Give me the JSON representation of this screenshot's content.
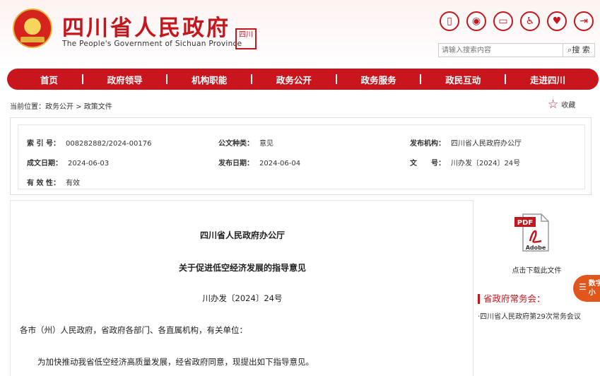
{
  "header": {
    "title": "四川省人民政府",
    "subtitle": "The People's Government of Sichuan Province",
    "seal_text": "四川"
  },
  "toolbar": {
    "icons": [
      "mobile-icon",
      "weibo-icon",
      "wechat-icon",
      "accessibility-icon",
      "elder-care-icon",
      "exit-icon"
    ]
  },
  "search": {
    "placeholder": "请输入搜索内容",
    "button_label": "搜 索"
  },
  "nav": {
    "items": [
      "首页",
      "政府领导",
      "机构职能",
      "政务公开",
      "政务服务",
      "政民互动",
      "走进四川"
    ]
  },
  "breadcrumb": {
    "prefix": "当前位置：",
    "path": "政务公开 > 政策文件"
  },
  "favorite_label": "收藏",
  "meta": {
    "index_label": "索 引 号：",
    "index_value": "008282882/2024-00176",
    "type_label": "公文种类：",
    "type_value": "意见",
    "issuer_label": "发布机构：",
    "issuer_value": "四川省人民政府办公厅",
    "created_label": "成文日期：",
    "created_value": "2024-06-03",
    "published_label": "发布日期：",
    "published_value": "2024-06-04",
    "docno_label": "文　　号：",
    "docno_value": "川办发〔2024〕24号",
    "validity_label": "有 效 性：",
    "validity_value": "有效"
  },
  "document": {
    "issuer": "四川省人民政府办公厅",
    "title": "关于促进低空经济发展的指导意见",
    "number": "川办发〔2024〕24号",
    "recipient": "各市（州）人民政府，省政府各部门、各直属机构，有关单位：",
    "paragraph": "为加快推动我省低空经济高质量发展，经省政府同意，现提出如下指导意见。"
  },
  "sidebar": {
    "download_label": "点击下载此文件",
    "meeting_heading": "省政府常务会：",
    "meeting_link": "·四川省人民政府第29次常务会议"
  },
  "float_tab": {
    "line1": "数字",
    "line2": "小"
  },
  "colors": {
    "brand_red": "#c9161e",
    "float_orange": "#e0561b"
  }
}
